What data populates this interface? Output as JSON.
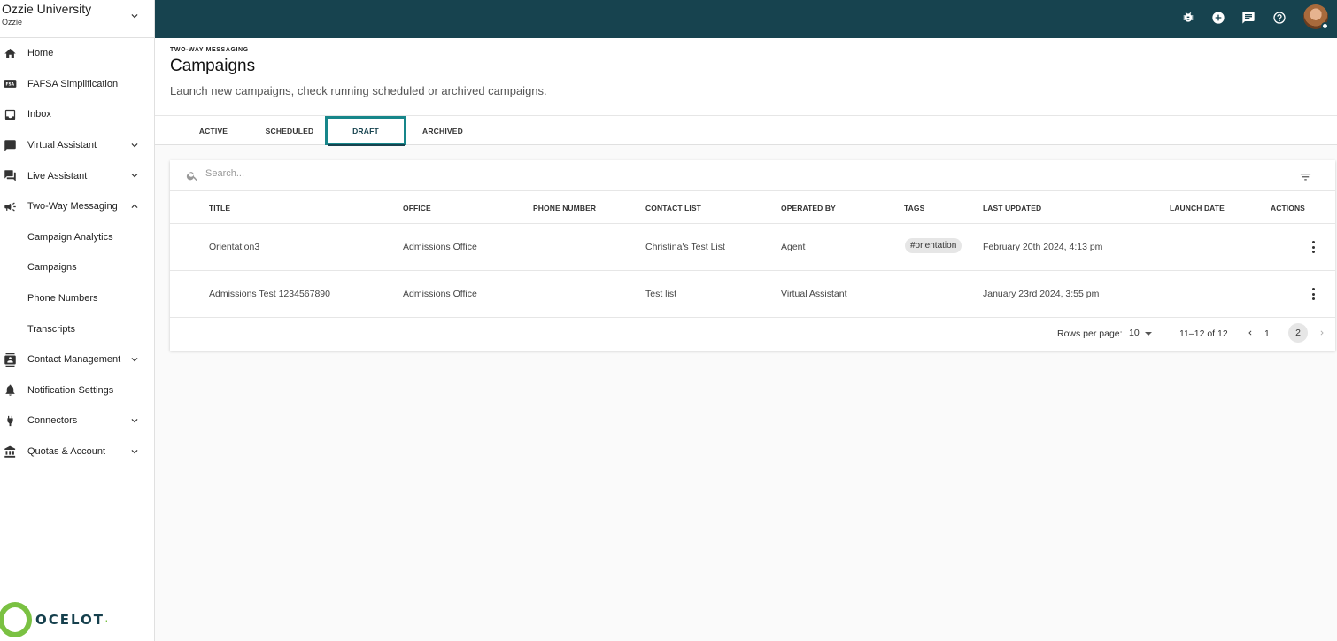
{
  "org": {
    "name": "Ozzie University",
    "sub": "Ozzie"
  },
  "nav": [
    {
      "label": "Home",
      "icon": "home-icon"
    },
    {
      "label": "FAFSA Simplification",
      "icon": "fsa-icon"
    },
    {
      "label": "Inbox",
      "icon": "inbox-icon"
    },
    {
      "label": "Virtual Assistant",
      "icon": "chat-icon"
    },
    {
      "label": "Live Assistant",
      "icon": "forum-icon"
    },
    {
      "label": "Two-Way Messaging",
      "icon": "campaign-icon"
    },
    {
      "label": "Campaign Analytics"
    },
    {
      "label": "Campaigns"
    },
    {
      "label": "Phone Numbers"
    },
    {
      "label": "Transcripts"
    },
    {
      "label": "Contact Management",
      "icon": "contacts-icon"
    },
    {
      "label": "Notification Settings",
      "icon": "bell-icon"
    },
    {
      "label": "Connectors",
      "icon": "plug-icon"
    },
    {
      "label": "Quotas & Account",
      "icon": "bank-icon"
    }
  ],
  "logo": {
    "text": "OCELOT"
  },
  "header": {
    "eyebrow": "TWO-WAY MESSAGING",
    "title": "Campaigns",
    "subtitle": "Launch new campaigns, check running scheduled or archived campaigns."
  },
  "tabs": [
    "ACTIVE",
    "SCHEDULED",
    "DRAFT",
    "ARCHIVED"
  ],
  "active_tab": "DRAFT",
  "search": {
    "placeholder": "Search..."
  },
  "columns": [
    "TITLE",
    "OFFICE",
    "PHONE NUMBER",
    "CONTACT LIST",
    "OPERATED BY",
    "TAGS",
    "LAST UPDATED",
    "LAUNCH DATE",
    "ACTIONS"
  ],
  "rows": [
    {
      "title": "Orientation3",
      "office": "Admissions Office",
      "phone": "",
      "contact_list": "Christina's Test List",
      "operated_by": "Agent",
      "tag": "#orientation",
      "last_updated": "February 20th 2024, 4:13 pm",
      "launch_date": ""
    },
    {
      "title": "Admissions Test 1234567890",
      "office": "Admissions Office",
      "phone": "",
      "contact_list": "Test list",
      "operated_by": "Virtual Assistant",
      "tag": "",
      "last_updated": "January 23rd 2024, 3:55 pm",
      "launch_date": ""
    }
  ],
  "pager": {
    "rows_per_page_label": "Rows per page:",
    "rows_per_page": "10",
    "range": "11–12 of 12",
    "page1": "1",
    "page2": "2"
  },
  "colors": {
    "topbar": "#17434f",
    "accent": "#17868a",
    "logo_green": "#7ac142"
  }
}
